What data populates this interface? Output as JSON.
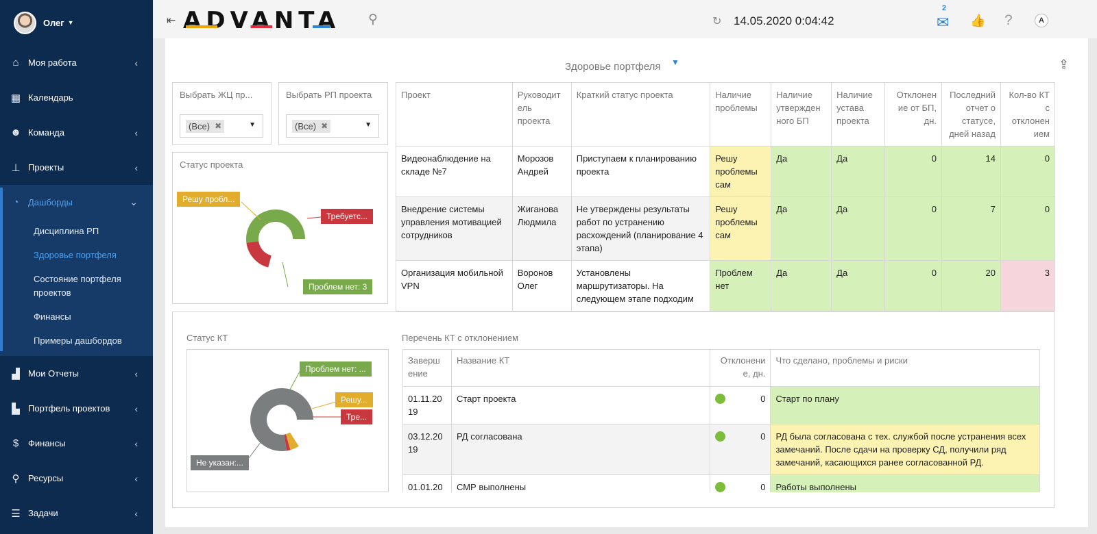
{
  "user": {
    "name": "Олег"
  },
  "sidebar": {
    "items": [
      {
        "label": "Моя работа",
        "icon": "home-icon"
      },
      {
        "label": "Календарь",
        "icon": "calendar-icon"
      },
      {
        "label": "Команда",
        "icon": "team-icon"
      },
      {
        "label": "Проекты",
        "icon": "hierarchy-icon"
      },
      {
        "label": "Дашборды",
        "icon": "dashboard-icon"
      },
      {
        "label": "Мои Отчеты",
        "icon": "chart-icon"
      },
      {
        "label": "Портфель проектов",
        "icon": "gantt-icon"
      },
      {
        "label": "Финансы",
        "icon": "dollar-icon"
      },
      {
        "label": "Ресурсы",
        "icon": "runner-icon"
      },
      {
        "label": "Задачи",
        "icon": "tasks-icon"
      }
    ],
    "sub_items": [
      "Дисциплина РП",
      "Здоровье портфеля",
      "Состояние портфеля проектов",
      "Финансы",
      "Примеры дашбордов"
    ]
  },
  "topbar": {
    "logo": "ADVANTA",
    "datetime": "14.05.2020 0:04:42",
    "mail_count": "2",
    "account_initial": "A"
  },
  "dashboard": {
    "title": "Здоровье портфеля",
    "filters": [
      {
        "label": "Выбрать ЖЦ пр...",
        "value": "(Все)"
      },
      {
        "label": "Выбрать РП проекта",
        "value": "(Все)"
      }
    ],
    "project_status": {
      "title": "Статус проекта",
      "labels": [
        "Решу пробл...",
        "Требуетс...",
        "Проблем нет: 3"
      ]
    },
    "kt_status": {
      "title": "Статус КТ",
      "labels": [
        "Проблем нет: ...",
        "Решу...",
        "Тре...",
        "Не указан:..."
      ]
    },
    "kt_list_title": "Перечень КТ с отклонением"
  },
  "projects": {
    "headers": [
      "Проект",
      "Руководит ель проекта",
      "Краткий статус проекта",
      "Наличие проблемы",
      "Наличие утвержден ного БП",
      "Наличие устава проекта",
      "Отклонен ие от БП, дн.",
      "Последний отчет о статусе, дней назад",
      "Кол-во КТ с отклонен ием"
    ],
    "rows": [
      [
        "Видеонаблюдение на складе №7",
        "Морозов Андрей",
        "Приступаем к планированию проекта",
        "Решу проблемы сам",
        "Да",
        "Да",
        "0",
        "14",
        "0"
      ],
      [
        "Внедрение системы управления мотивацией сотрудников",
        "Жиганова Людмила",
        "Не утверждены результаты работ по устранению расхождений (планирование 4 этапа)",
        "Решу проблемы сам",
        "Да",
        "Да",
        "0",
        "7",
        "0"
      ],
      [
        "Организация мобильной VPN",
        "Воронов Олег",
        "Установлены маршрутизаторы. На следующем этапе подходим",
        "Проблем нет",
        "Да",
        "Да",
        "0",
        "20",
        "3"
      ]
    ]
  },
  "kt": {
    "headers": [
      "Заверш ение",
      "Название КТ",
      "Отклонени е, дн.",
      "Что сделано, проблемы и риски"
    ],
    "rows": [
      [
        "01.11.20 19",
        "Старт проекта",
        "0",
        "Старт по плану"
      ],
      [
        "03.12.20 19",
        "РД согласована",
        "0",
        "РД была согласована с тех. службой после устранения всех замечаний. После сдачи на проверку СД, получили ряд замечаний, касающихся ранее согласованной РД."
      ],
      [
        "01.01.20",
        "СМР выполнены",
        "0",
        "Работы выполнены"
      ]
    ]
  },
  "colors": {
    "sidebar": "#0d2a4f",
    "accent": "#2f7fd1",
    "yellow": "#e2ad2c",
    "red": "#c9383f",
    "green": "#78a94a",
    "grey": "#7b7e7f"
  }
}
